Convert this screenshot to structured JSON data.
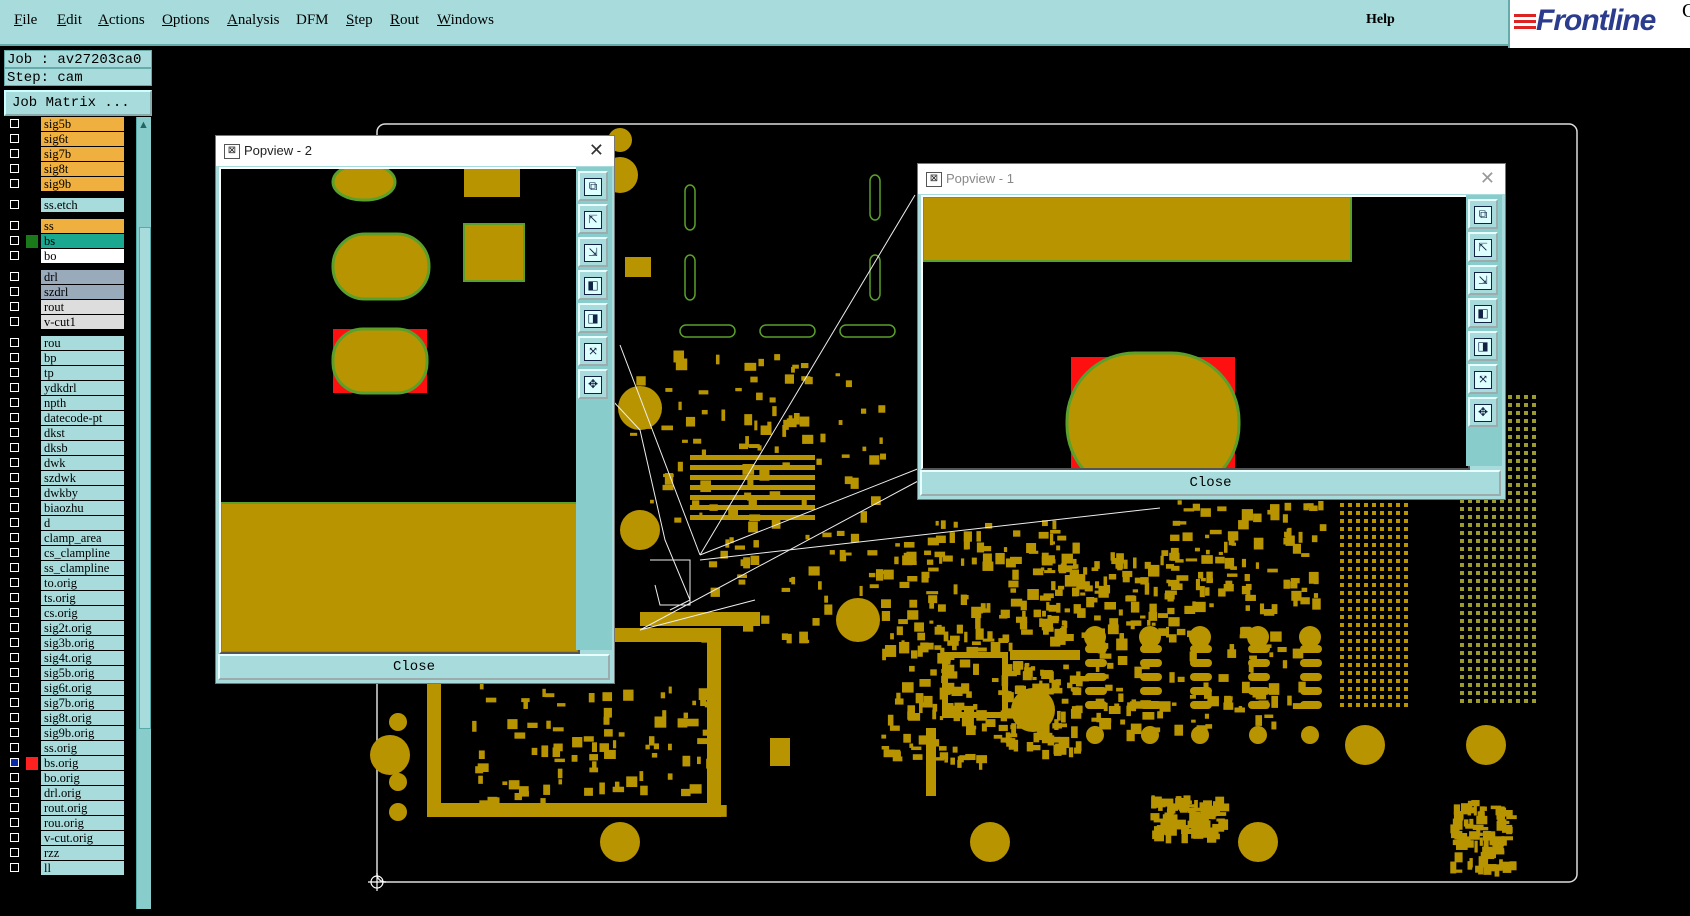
{
  "menubar": {
    "items": [
      {
        "label": "File",
        "mn": "F",
        "rest": "ile"
      },
      {
        "label": "Edit",
        "mn": "E",
        "rest": "dit"
      },
      {
        "label": "Actions",
        "mn": "A",
        "rest": "ctions"
      },
      {
        "label": "Options",
        "mn": "O",
        "rest": "ptions"
      },
      {
        "label": "Analysis",
        "mn": "A",
        "rest": "nalysis"
      },
      {
        "label": "DFM",
        "mn": "",
        "rest": "DFM"
      },
      {
        "label": "Step",
        "mn": "S",
        "rest": "tep"
      },
      {
        "label": "Rout",
        "mn": "R",
        "rest": "out"
      },
      {
        "label": "Windows",
        "mn": "W",
        "rest": "indows"
      }
    ],
    "help": "Help"
  },
  "logo": {
    "text": "Frontline",
    "suffix": "G"
  },
  "job_info": {
    "job": "Job : av27203ca0",
    "step": "Step: cam"
  },
  "job_matrix_label": "Job Matrix ...",
  "layers": [
    {
      "name": "sig5b",
      "color": "#f0b040"
    },
    {
      "name": "sig6t",
      "color": "#f0b040"
    },
    {
      "name": "sig7b",
      "color": "#f0b040"
    },
    {
      "name": "sig8t",
      "color": "#f0b040"
    },
    {
      "name": "sig9b",
      "color": "#f0b040"
    },
    {
      "gap": true
    },
    {
      "name": "ss.etch",
      "color": "#a8dcdc"
    },
    {
      "gap": true
    },
    {
      "name": "ss",
      "color": "#f0b040",
      "flag": "⬋"
    },
    {
      "name": "bs",
      "color": "#1aa890",
      "swatch": "#1a7a1a"
    },
    {
      "name": "bo",
      "color": "#ffffff",
      "flag": "⬋"
    },
    {
      "gap": true
    },
    {
      "name": "drl",
      "color": "#9ab"
    },
    {
      "name": "szdrl",
      "color": "#9ab"
    },
    {
      "name": "rout",
      "color": "#ddd"
    },
    {
      "name": "v-cut1",
      "color": "#ddd"
    },
    {
      "gap": true
    },
    {
      "name": "rou",
      "color": "#a8dcdc"
    },
    {
      "name": "bp",
      "color": "#a8dcdc"
    },
    {
      "name": "tp",
      "color": "#a8dcdc"
    },
    {
      "name": "ydkdrl",
      "color": "#a8dcdc"
    },
    {
      "name": "npth",
      "color": "#a8dcdc"
    },
    {
      "name": "datecode-pt",
      "color": "#a8dcdc"
    },
    {
      "name": "dkst",
      "color": "#a8dcdc"
    },
    {
      "name": "dksb",
      "color": "#a8dcdc"
    },
    {
      "name": "dwk",
      "color": "#a8dcdc"
    },
    {
      "name": "szdwk",
      "color": "#a8dcdc"
    },
    {
      "name": "dwkby",
      "color": "#a8dcdc"
    },
    {
      "name": "biaozhu",
      "color": "#a8dcdc"
    },
    {
      "name": "d",
      "color": "#a8dcdc"
    },
    {
      "name": "clamp_area",
      "color": "#a8dcdc"
    },
    {
      "name": "cs_clampline",
      "color": "#a8dcdc"
    },
    {
      "name": "ss_clampline",
      "color": "#a8dcdc"
    },
    {
      "name": "to.orig",
      "color": "#a8dcdc",
      "flag": "⬋"
    },
    {
      "name": "ts.orig",
      "color": "#a8dcdc"
    },
    {
      "name": "cs.orig",
      "color": "#a8dcdc"
    },
    {
      "name": "sig2t.orig",
      "color": "#a8dcdc"
    },
    {
      "name": "sig3b.orig",
      "color": "#a8dcdc"
    },
    {
      "name": "sig4t.orig",
      "color": "#a8dcdc"
    },
    {
      "name": "sig5b.orig",
      "color": "#a8dcdc"
    },
    {
      "name": "sig6t.orig",
      "color": "#a8dcdc"
    },
    {
      "name": "sig7b.orig",
      "color": "#a8dcdc"
    },
    {
      "name": "sig8t.orig",
      "color": "#a8dcdc"
    },
    {
      "name": "sig9b.orig",
      "color": "#a8dcdc"
    },
    {
      "name": "ss.orig",
      "color": "#a8dcdc",
      "flag": "⬋"
    },
    {
      "name": "bs.orig",
      "color": "#a8dcdc",
      "swatch": "#ff2020",
      "checked": true,
      "flag": "≡"
    },
    {
      "name": "bo.orig",
      "color": "#a8dcdc",
      "flag": "⬋"
    },
    {
      "name": "drl.orig",
      "color": "#a8dcdc"
    },
    {
      "name": "rout.orig",
      "color": "#a8dcdc"
    },
    {
      "name": "rou.orig",
      "color": "#a8dcdc"
    },
    {
      "name": "v-cut.orig",
      "color": "#a8dcdc"
    },
    {
      "name": "rzz",
      "color": "#a8dcdc"
    },
    {
      "name": "ll",
      "color": "#a8dcdc"
    }
  ],
  "popview2": {
    "title": "Popview - 2",
    "close_label": "Close"
  },
  "popview1": {
    "title": "Popview - 1",
    "close_label": "Close"
  },
  "colors": {
    "copper": "#b89500",
    "outline": "#5aa02a",
    "highlight": "#ff1010",
    "ui": "#a8dcdc"
  }
}
